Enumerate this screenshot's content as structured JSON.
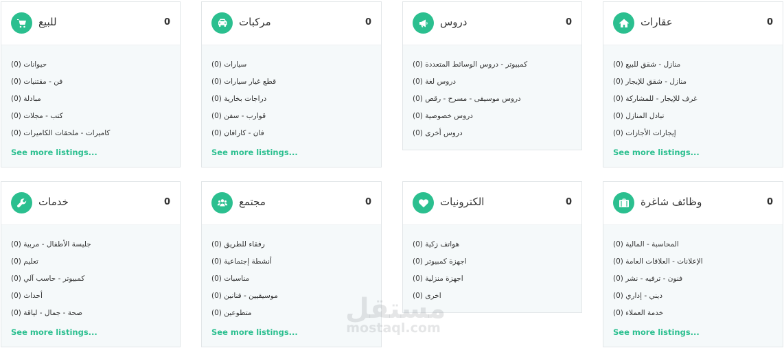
{
  "categories": [
    {
      "title": "للبيع",
      "count": "0",
      "icon": "shopping-cart-icon",
      "items": [
        "(حيوانات (0",
        "(فن - مقتنيات (0",
        "(مبادلة (0",
        "(كتب - مجلات (0",
        "(كاميرات - ملحقات الكاميرات (0"
      ],
      "more_label": "See more listings..."
    },
    {
      "title": "مركبات",
      "count": "0",
      "icon": "car-icon",
      "items": [
        "(سيارات (0",
        "(قطع غيار سيارات (0",
        "(دراجات بخارية (0",
        "(قوارب - سفن (0",
        "(فان - كارافان (0"
      ],
      "more_label": "See more listings..."
    },
    {
      "title": "دروس",
      "count": "0",
      "icon": "megaphone-icon",
      "items": [
        "(كمبيوتر - دروس الوسائط المتعددة (0",
        "(دروس لغة (0",
        "(دروس موسيقى - مسرح - رقص (0",
        "(دروس خصوصية (0",
        "(دروس أخرى (0"
      ],
      "more_label": ""
    },
    {
      "title": "عقارات",
      "count": "0",
      "icon": "home-icon",
      "items": [
        "(منازل - شقق للبيع (0",
        "(منازل - شقق للإيجار (0",
        "(غرف للإيجار - للمشاركة (0",
        "(تبادل المنازل (0",
        "(إيجارات الأجازات (0"
      ],
      "more_label": "See more listings..."
    },
    {
      "title": "خدمات",
      "count": "0",
      "icon": "wrench-icon",
      "items": [
        "(جليسة الأطفال - مربية (0",
        "(تعليم (0",
        "(كمبيوتر - حاسب آلي (0",
        "(أحداث (0",
        "(صحة - جمال - لياقة (0"
      ],
      "more_label": "See more listings..."
    },
    {
      "title": "مجتمع",
      "count": "0",
      "icon": "group-icon",
      "items": [
        "(رفقاء للطريق (0",
        "(أنشطة إجتماعية (0",
        "(مناسبات (0",
        "(موسيقيين - فنانين (0",
        "(متطوعين (0"
      ],
      "more_label": "See more listings..."
    },
    {
      "title": "الكترونيات",
      "count": "0",
      "icon": "heart-icon",
      "items": [
        "(هواتف زكية (0",
        "(اجهزة كمبيوتر (0",
        "(اجهزة منزلية (0",
        "(اخرى (0"
      ],
      "more_label": ""
    },
    {
      "title": "وظائف شاغرة",
      "count": "0",
      "icon": "briefcase-icon",
      "items": [
        "(المحاسبة - المالية (0",
        "(الإعلانات - العلاقات العامة (0",
        "(فنون - ترفيه - نشر (0",
        "(ديني - إداري (0",
        "(خدمة العملاء (0"
      ],
      "more_label": "See more listings..."
    }
  ],
  "watermark": {
    "arabic": "مستقل",
    "latin": "mostaql.com"
  },
  "accent_color": "#2bbf8f"
}
